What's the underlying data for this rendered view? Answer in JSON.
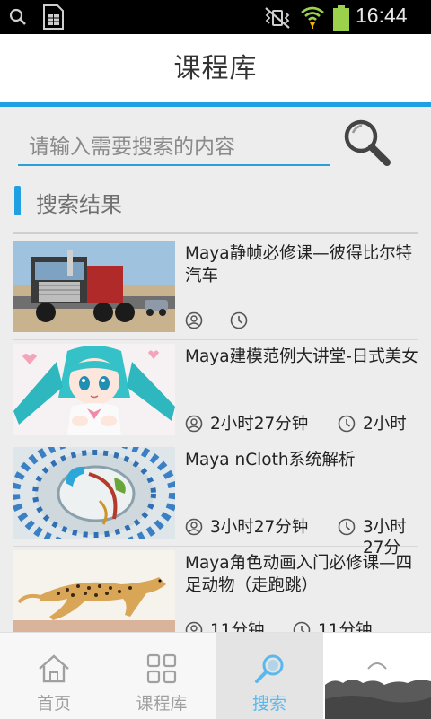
{
  "status_bar": {
    "time": "16:44"
  },
  "header": {
    "title": "课程库"
  },
  "search": {
    "placeholder": "请输入需要搜索的内容"
  },
  "section": {
    "title": "搜索结果"
  },
  "results": [
    {
      "title": "Maya静帧必修课—彼得比尔特汽车",
      "total_duration": "",
      "duration": "",
      "thumb_icon": "truck-image"
    },
    {
      "title": "Maya建模范例大讲堂-日式美女",
      "total_duration": "2小时27分钟",
      "duration": "2小时",
      "thumb_icon": "anime-girl-image"
    },
    {
      "title": "Maya nCloth系统解析",
      "total_duration": "3小时27分钟",
      "duration": "3小时27分",
      "thumb_icon": "cloth-tunnel-image"
    },
    {
      "title": "Maya角色动画入门必修课—四足动物（走跑跳）",
      "total_duration": "11分钟",
      "duration": "11分钟",
      "thumb_icon": "cheetah-image"
    }
  ],
  "nav": {
    "items": [
      {
        "label": "首页",
        "icon": "home-icon"
      },
      {
        "label": "课程库",
        "icon": "grid-icon"
      },
      {
        "label": "搜索",
        "icon": "search-icon"
      }
    ]
  },
  "colors": {
    "accent": "#1fa0e3",
    "active_nav": "#5ab8ee"
  }
}
